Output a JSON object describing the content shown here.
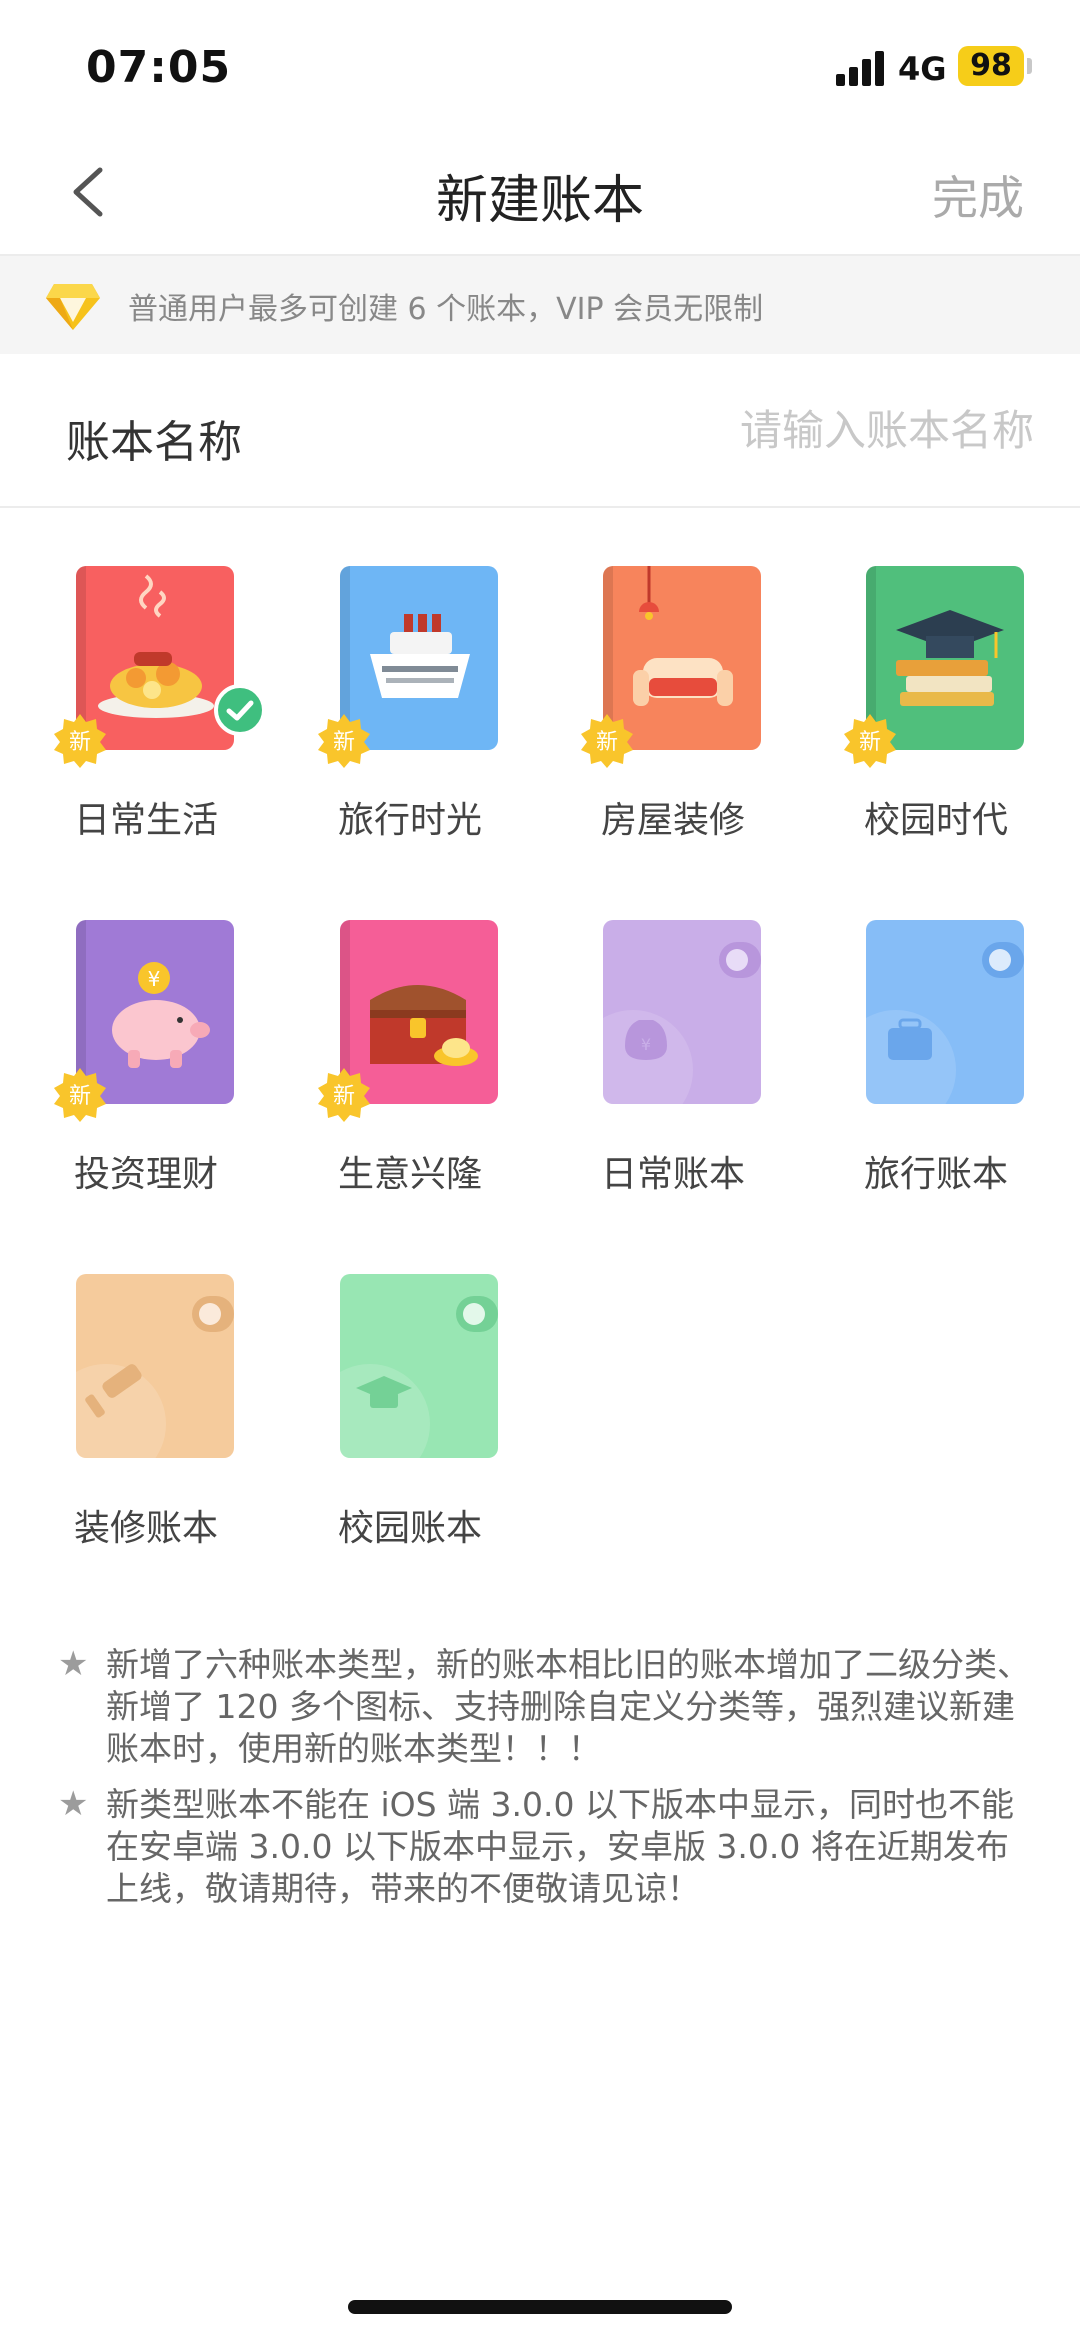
{
  "status_bar": {
    "time": "07:05",
    "network": "4G",
    "battery": "98"
  },
  "nav": {
    "title": "新建账本",
    "done_label": "完成"
  },
  "notice": {
    "text": "普通用户最多可创建 6 个账本，VIP 会员无限制"
  },
  "name_field": {
    "label": "账本名称",
    "placeholder": "请输入账本名称",
    "value": ""
  },
  "new_badge": "新",
  "books": [
    {
      "label": "日常生活",
      "color": "#f86060",
      "is_new": true,
      "selected": true,
      "icon": "food-plate-icon"
    },
    {
      "label": "旅行时光",
      "color": "#6eb6f5",
      "is_new": true,
      "selected": false,
      "icon": "cruise-ship-icon"
    },
    {
      "label": "房屋装修",
      "color": "#f7845c",
      "is_new": true,
      "selected": false,
      "icon": "sofa-lamp-icon"
    },
    {
      "label": "校园时代",
      "color": "#50bf7c",
      "is_new": true,
      "selected": false,
      "icon": "graduation-books-icon"
    },
    {
      "label": "投资理财",
      "color": "#a07ad6",
      "is_new": true,
      "selected": false,
      "icon": "piggy-bank-icon"
    },
    {
      "label": "生意兴隆",
      "color": "#f55e97",
      "is_new": true,
      "selected": false,
      "icon": "treasure-chest-icon"
    },
    {
      "label": "日常账本",
      "color": "#c9aee8",
      "is_new": false,
      "selected": false,
      "icon": "money-bag-icon"
    },
    {
      "label": "旅行账本",
      "color": "#86bdf7",
      "is_new": false,
      "selected": false,
      "icon": "suitcase-icon"
    },
    {
      "label": "装修账本",
      "color": "#f5cb9c",
      "is_new": false,
      "selected": false,
      "icon": "paint-roller-icon"
    },
    {
      "label": "校园账本",
      "color": "#98e6b3",
      "is_new": false,
      "selected": false,
      "icon": "graduation-cap-icon"
    }
  ],
  "tips": [
    "新增了六种账本类型，新的账本相比旧的账本增加了二级分类、新增了 120 多个图标、支持删除自定义分类等，强烈建议新建账本时，使用新的账本类型！！！",
    "新类型账本不能在 iOS 端 3.0.0 以下版本中显示，同时也不能在安卓端 3.0.0 以下版本中显示，安卓版 3.0.0 将在近期发布上线，敬请期待，带来的不便敬请见谅！"
  ],
  "colors": {
    "accent": "#f6cd19",
    "check": "#3fbf7f"
  }
}
